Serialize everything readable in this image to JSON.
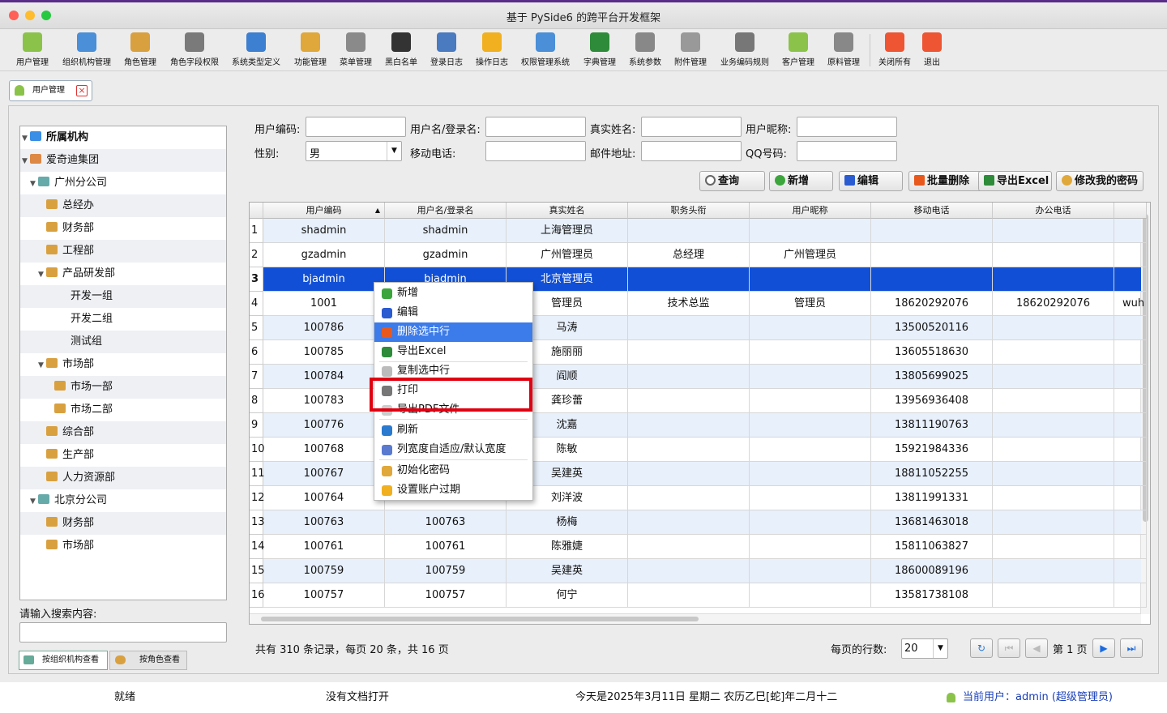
{
  "window": {
    "title": "基于 PySide6 的跨平台开发框架"
  },
  "toolbar": [
    "用户管理",
    "组织机构管理",
    "角色管理",
    "角色字段权限",
    "系统类型定义",
    "功能管理",
    "菜单管理",
    "黑白名单",
    "登录日志",
    "操作日志",
    "权限管理系统",
    "字典管理",
    "系统参数",
    "附件管理",
    "业务编码规则",
    "客户管理",
    "原料管理",
    "关闭所有",
    "退出"
  ],
  "tab": {
    "label": "用户管理"
  },
  "tree": {
    "root": "所属机构",
    "items": [
      "爱奇迪集团",
      "广州分公司",
      "总经办",
      "财务部",
      "工程部",
      "产品研发部",
      "开发一组",
      "开发二组",
      "测试组",
      "市场部",
      "市场一部",
      "市场二部",
      "综合部",
      "生产部",
      "人力资源部",
      "北京分公司",
      "财务部",
      "市场部"
    ]
  },
  "search": {
    "label": "请输入搜索内容:",
    "placeholder": ""
  },
  "form": {
    "user_code": "用户编码:",
    "login_name": "用户名/登录名:",
    "real_name": "真实姓名:",
    "nickname": "用户昵称:",
    "gender": "性别:",
    "gender_value": "男",
    "mobile": "移动电话:",
    "email": "邮件地址:",
    "qq": "QQ号码:"
  },
  "buttons": {
    "query": "查询",
    "add": "新增",
    "edit": "编辑",
    "batch_delete": "批量删除",
    "export_excel": "导出Excel",
    "change_password": "修改我的密码"
  },
  "table": {
    "columns": [
      "用户编码",
      "用户名/登录名",
      "真实姓名",
      "职务头衔",
      "用户昵称",
      "移动电话",
      "办公电话"
    ],
    "rows": [
      [
        "1",
        "shadmin",
        "shadmin",
        "上海管理员",
        "",
        "",
        "",
        ""
      ],
      [
        "2",
        "gzadmin",
        "gzadmin",
        "广州管理员",
        "总经理",
        "广州管理员",
        "",
        ""
      ],
      [
        "3",
        "bjadmin",
        "bjadmin",
        "北京管理员",
        "",
        "",
        "",
        ""
      ],
      [
        "4",
        "1001",
        "",
        "管理员",
        "技术总监",
        "管理员",
        "18620292076",
        "18620292076"
      ],
      [
        "5",
        "100786",
        "",
        "马涛",
        "",
        "",
        "13500520116",
        ""
      ],
      [
        "6",
        "100785",
        "",
        "施丽丽",
        "",
        "",
        "13605518630",
        ""
      ],
      [
        "7",
        "100784",
        "",
        "阎顺",
        "",
        "",
        "13805699025",
        ""
      ],
      [
        "8",
        "100783",
        "",
        "龚珍蕾",
        "",
        "",
        "13956936408",
        ""
      ],
      [
        "9",
        "100776",
        "",
        "沈嘉",
        "",
        "",
        "13811190763",
        ""
      ],
      [
        "10",
        "100768",
        "",
        "陈敏",
        "",
        "",
        "15921984336",
        ""
      ],
      [
        "11",
        "100767",
        "",
        "吴建英",
        "",
        "",
        "18811052255",
        ""
      ],
      [
        "12",
        "100764",
        "",
        "刘洋波",
        "",
        "",
        "13811991331",
        ""
      ],
      [
        "13",
        "100763",
        "100763",
        "杨梅",
        "",
        "",
        "13681463018",
        ""
      ],
      [
        "14",
        "100761",
        "100761",
        "陈雅婕",
        "",
        "",
        "15811063827",
        ""
      ],
      [
        "15",
        "100759",
        "100759",
        "吴建英",
        "",
        "",
        "18600089196",
        ""
      ],
      [
        "16",
        "100757",
        "100757",
        "何宁",
        "",
        "",
        "13581738108",
        ""
      ]
    ],
    "overflow_text": "wuh"
  },
  "context_menu": [
    "新增",
    "编辑",
    "删除选中行",
    "导出Excel",
    "复制选中行",
    "打印",
    "导出PDF文件",
    "刷新",
    "列宽度自适应/默认宽度",
    "初始化密码",
    "设置账户过期"
  ],
  "pager": {
    "summary": "共有 310 条记录，每页 20 条，共 16 页",
    "rows_label": "每页的行数:",
    "rows_value": "20",
    "page_label": "第 1 页"
  },
  "bottom_tabs": [
    "按组织机构查看",
    "按角色查看"
  ],
  "status": {
    "ready": "就绪",
    "doc": "没有文档打开",
    "date": "今天是2025年3月11日 星期二 农历乙巳[蛇]年二月十二",
    "user": "当前用户：admin (超级管理员)"
  }
}
